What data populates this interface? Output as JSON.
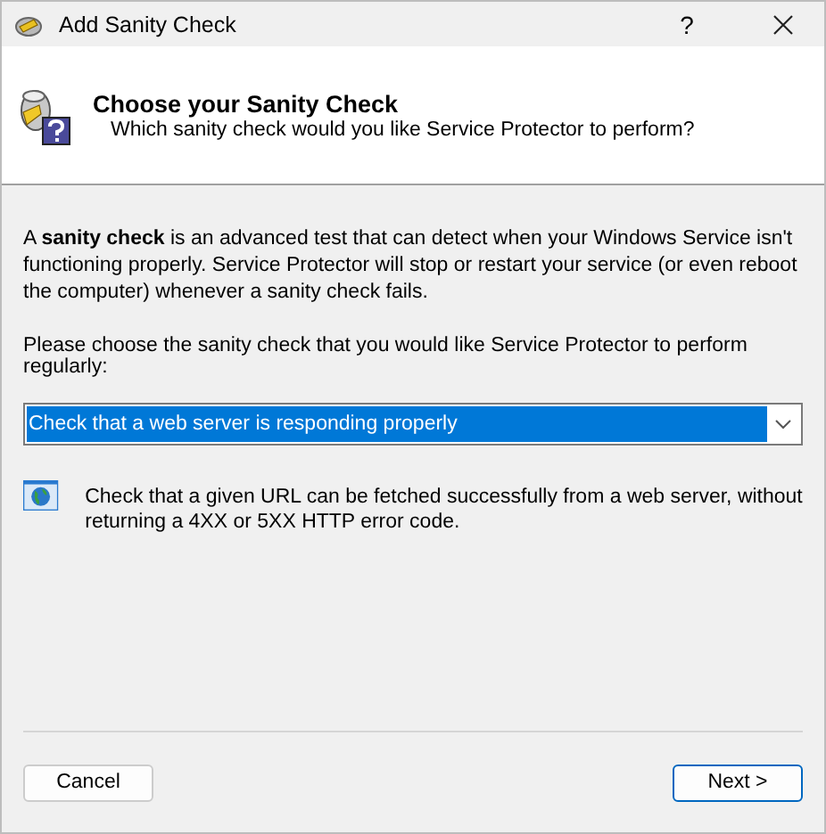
{
  "window": {
    "title": "Add Sanity Check",
    "help_button": "?"
  },
  "header": {
    "title": "Choose your Sanity Check",
    "subtitle": "Which sanity check would you like Service Protector to perform?"
  },
  "intro": "A **sanity check** is an advanced test that can detect when your Windows Service isn't functioning properly. Service Protector will stop or restart your service (or even reboot the computer) whenever a sanity check fails.",
  "prompt": "Please choose the sanity check that you would like Service Protector to perform regularly:",
  "dropdown": {
    "value": "Check that a web server is responding properly",
    "focused": true
  },
  "description": "Check that a given URL can be fetched successfully from a web server, without returning a 4XX or 5XX HTTP error code.",
  "buttons": [
    {
      "label": "Cancel",
      "default": false
    },
    {
      "label": "Next >",
      "default": true
    }
  ]
}
